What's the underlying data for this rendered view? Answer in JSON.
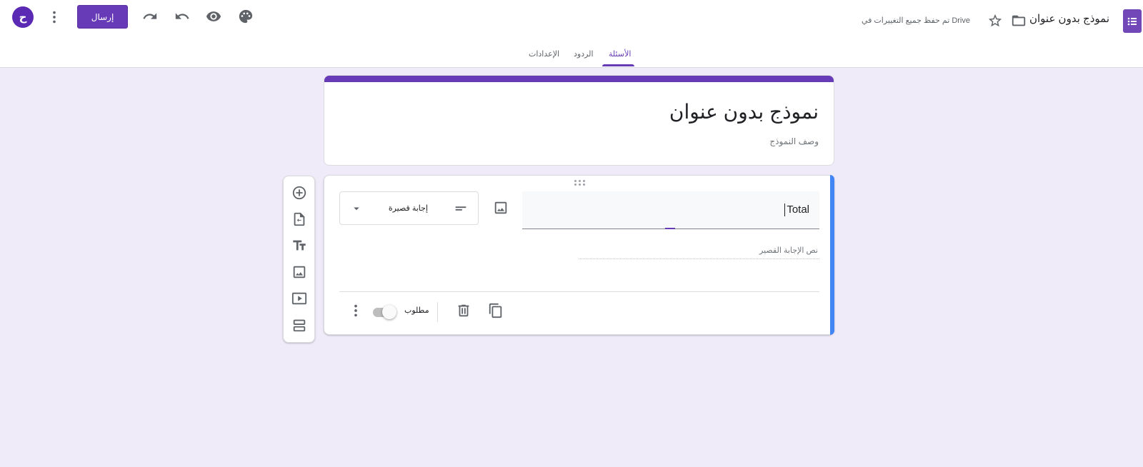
{
  "header": {
    "avatar_initial": "ح",
    "more_icon": "more-vert-icon",
    "send_label": "إرسال",
    "redo_icon": "redo-icon",
    "undo_icon": "undo-icon",
    "preview_icon": "eye-icon",
    "theme_icon": "palette-icon",
    "saved_status": "تم حفظ جميع التغييرات في Drive",
    "star_icon": "star-icon",
    "folder_icon": "folder-icon",
    "doc_title": "نموذج بدون عنوان",
    "logo_icon": "google-forms-icon",
    "accent_color": "#673ab7"
  },
  "tabs": [
    {
      "label": "الأسئلة",
      "active": true
    },
    {
      "label": "الردود",
      "active": false
    },
    {
      "label": "الإعدادات",
      "active": false
    }
  ],
  "title_card": {
    "title": "نموذج بدون عنوان",
    "description": "وصف النموذج"
  },
  "question": {
    "text": "Total",
    "type_label": "إجابة قصيرة",
    "answer_hint": "نص الإجابة القصير",
    "required_label": "مطلوب",
    "required": false
  },
  "side_toolbar": [
    "add-question-icon",
    "import-questions-icon",
    "add-title-icon",
    "add-image-icon",
    "add-video-icon",
    "add-section-icon"
  ],
  "colors": {
    "background": "#f0ebf8",
    "active_question_bar": "#4285f4"
  }
}
